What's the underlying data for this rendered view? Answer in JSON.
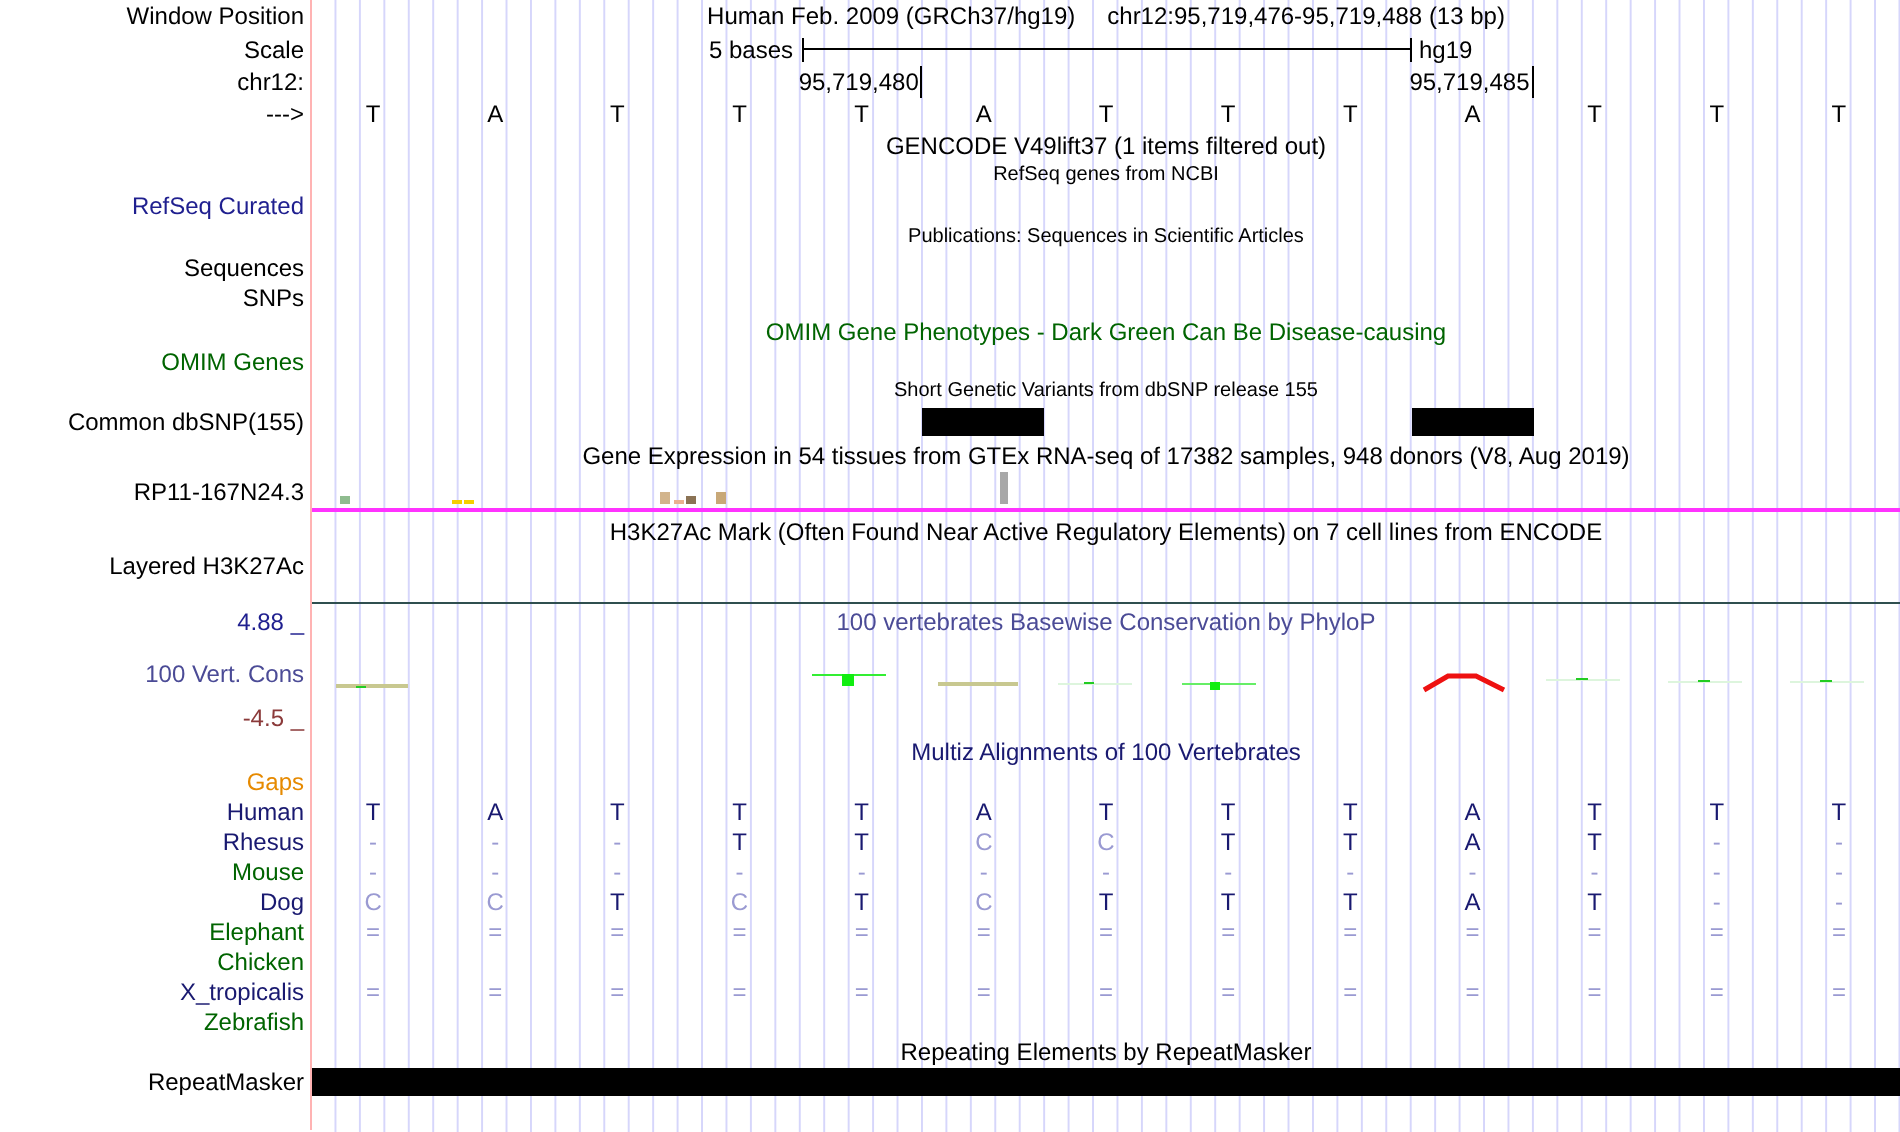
{
  "position": {
    "label": "Window Position",
    "assembly": "Human Feb. 2009 (GRCh37/hg19)",
    "range": "chr12:95,719,476-95,719,488 (13 bp)"
  },
  "scale": {
    "label": "Scale",
    "span": "5 bases",
    "assembly": "hg19"
  },
  "coordinates": {
    "label": "chr12:",
    "ticks": [
      "95,719,480",
      "95,719,485"
    ]
  },
  "sequence": {
    "label": "--->",
    "bases": [
      "T",
      "A",
      "T",
      "T",
      "T",
      "A",
      "T",
      "T",
      "T",
      "A",
      "T",
      "T",
      "T"
    ]
  },
  "tracks": [
    {
      "kind": "genes",
      "title": "GENCODE V49lift37 (1 items filtered out)"
    },
    {
      "kind": "refseq",
      "title": "RefSeq genes from NCBI",
      "labels": [
        "RefSeq Curated"
      ]
    },
    {
      "kind": "publications",
      "title": "Publications: Sequences in Scientific Articles",
      "labels": [
        "Sequences",
        "SNPs"
      ]
    },
    {
      "kind": "omim",
      "title": "OMIM Gene Phenotypes - Dark Green Can Be Disease-causing",
      "labels": [
        "OMIM Genes"
      ]
    },
    {
      "kind": "snp",
      "title": "Short Genetic Variants from dbSNP release 155",
      "labels": [
        "Common dbSNP(155)"
      ],
      "covered": [
        false,
        false,
        false,
        false,
        false,
        true,
        false,
        false,
        false,
        true,
        false,
        false,
        false
      ]
    },
    {
      "kind": "expression",
      "title": "Gene Expression in 54 tissues from GTEx RNA-seq of 17382 samples, 948 donors (V8, Aug 2019)",
      "labels": [
        "RP11-167N24.3"
      ]
    },
    {
      "kind": "chromatin",
      "title": "H3K27Ac Mark (Often Found Near Active Regulatory Elements) on 7 cell lines from ENCODE",
      "labels": [
        "Layered H3K27Ac"
      ]
    },
    {
      "kind": "conservation",
      "title": "100 vertebrates Basewise Conservation by PhyloP",
      "labels": [
        "4.88 _",
        "100 Vert. Cons",
        "-4.5 _"
      ]
    },
    {
      "kind": "alignment",
      "title": "Multiz Alignments of 100 Vertebrates",
      "labels": [
        "Gaps"
      ],
      "species": [
        {
          "name": "Human",
          "color": "#191970",
          "cells": [
            {
              "base": "T",
              "match": true
            },
            {
              "base": "A",
              "match": true
            },
            {
              "base": "T",
              "match": true
            },
            {
              "base": "T",
              "match": true
            },
            {
              "base": "T",
              "match": true
            },
            {
              "base": "A",
              "match": true
            },
            {
              "base": "T",
              "match": true
            },
            {
              "base": "T",
              "match": true
            },
            {
              "base": "T",
              "match": true
            },
            {
              "base": "A",
              "match": true
            },
            {
              "base": "T",
              "match": true
            },
            {
              "base": "T",
              "match": true
            },
            {
              "base": "T",
              "match": true
            }
          ]
        },
        {
          "name": "Rhesus",
          "color": "#191970",
          "cells": [
            {
              "base": "-",
              "match": false
            },
            {
              "base": "-",
              "match": false
            },
            {
              "base": "-",
              "match": false
            },
            {
              "base": "T",
              "match": true
            },
            {
              "base": "T",
              "match": true
            },
            {
              "base": "C",
              "match": false
            },
            {
              "base": "C",
              "match": false
            },
            {
              "base": "T",
              "match": true
            },
            {
              "base": "T",
              "match": true
            },
            {
              "base": "A",
              "match": true
            },
            {
              "base": "T",
              "match": true
            },
            {
              "base": "-",
              "match": false
            },
            {
              "base": "-",
              "match": false
            }
          ]
        },
        {
          "name": "Mouse",
          "color": "#006400",
          "cells": [
            {
              "base": "-",
              "match": false
            },
            {
              "base": "-",
              "match": false
            },
            {
              "base": "-",
              "match": false
            },
            {
              "base": "-",
              "match": false
            },
            {
              "base": "-",
              "match": false
            },
            {
              "base": "-",
              "match": false
            },
            {
              "base": "-",
              "match": false
            },
            {
              "base": "-",
              "match": false
            },
            {
              "base": "-",
              "match": false
            },
            {
              "base": "-",
              "match": false
            },
            {
              "base": "-",
              "match": false
            },
            {
              "base": "-",
              "match": false
            },
            {
              "base": "-",
              "match": false
            }
          ]
        },
        {
          "name": "Dog",
          "color": "#191970",
          "cells": [
            {
              "base": "C",
              "match": false
            },
            {
              "base": "C",
              "match": false
            },
            {
              "base": "T",
              "match": true
            },
            {
              "base": "C",
              "match": false
            },
            {
              "base": "T",
              "match": true
            },
            {
              "base": "C",
              "match": false
            },
            {
              "base": "T",
              "match": true
            },
            {
              "base": "T",
              "match": true
            },
            {
              "base": "T",
              "match": true
            },
            {
              "base": "A",
              "match": true
            },
            {
              "base": "T",
              "match": true
            },
            {
              "base": "-",
              "match": false
            },
            {
              "base": "-",
              "match": false
            }
          ]
        },
        {
          "name": "Elephant",
          "color": "#006400",
          "cells": [
            {
              "base": "=",
              "match": false
            },
            {
              "base": "=",
              "match": false
            },
            {
              "base": "=",
              "match": false
            },
            {
              "base": "=",
              "match": false
            },
            {
              "base": "=",
              "match": false
            },
            {
              "base": "=",
              "match": false
            },
            {
              "base": "=",
              "match": false
            },
            {
              "base": "=",
              "match": false
            },
            {
              "base": "=",
              "match": false
            },
            {
              "base": "=",
              "match": false
            },
            {
              "base": "=",
              "match": false
            },
            {
              "base": "=",
              "match": false
            },
            {
              "base": "=",
              "match": false
            }
          ]
        },
        {
          "name": "Chicken",
          "color": "#006400"
        },
        {
          "name": "X_tropicalis",
          "color": "#191970",
          "cells": [
            {
              "base": "=",
              "match": false
            },
            {
              "base": "=",
              "match": false
            },
            {
              "base": "=",
              "match": false
            },
            {
              "base": "=",
              "match": false
            },
            {
              "base": "=",
              "match": false
            },
            {
              "base": "=",
              "match": false
            },
            {
              "base": "=",
              "match": false
            },
            {
              "base": "=",
              "match": false
            },
            {
              "base": "=",
              "match": false
            },
            {
              "base": "=",
              "match": false
            },
            {
              "base": "=",
              "match": false
            },
            {
              "base": "=",
              "match": false
            },
            {
              "base": "=",
              "match": false
            }
          ]
        },
        {
          "name": "Zebrafish",
          "color": "#006400"
        }
      ]
    },
    {
      "kind": "repeats",
      "title": "Repeating Elements by RepeatMasker",
      "labels": [
        "RepeatMasker"
      ]
    }
  ]
}
